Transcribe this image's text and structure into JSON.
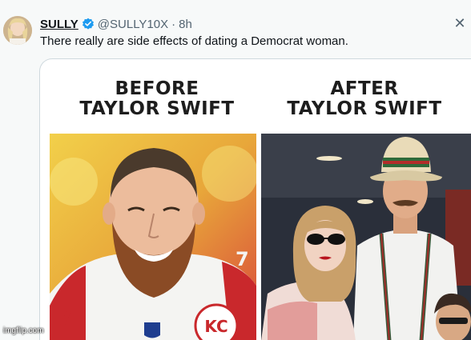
{
  "post": {
    "author_name": "SULLY",
    "handle": "@SULLY10X",
    "separator": "·",
    "timestamp": "8h",
    "close_glyph": "✕",
    "text": "There really are side effects of dating a Democrat woman."
  },
  "meme": {
    "left_title_line1": "BEFORE",
    "left_title_line2": "TAYLOR SWIFT",
    "right_title_line1": "AFTER",
    "right_title_line2": "TAYLOR SWIFT"
  },
  "watermark": "imgflip.com",
  "icons": {
    "verified": "verified-badge-icon",
    "close": "close-icon"
  },
  "colors": {
    "verified_blue": "#1d9bf0",
    "text_primary": "#0f1419",
    "text_secondary": "#536471",
    "card_border": "#cfd9de"
  }
}
